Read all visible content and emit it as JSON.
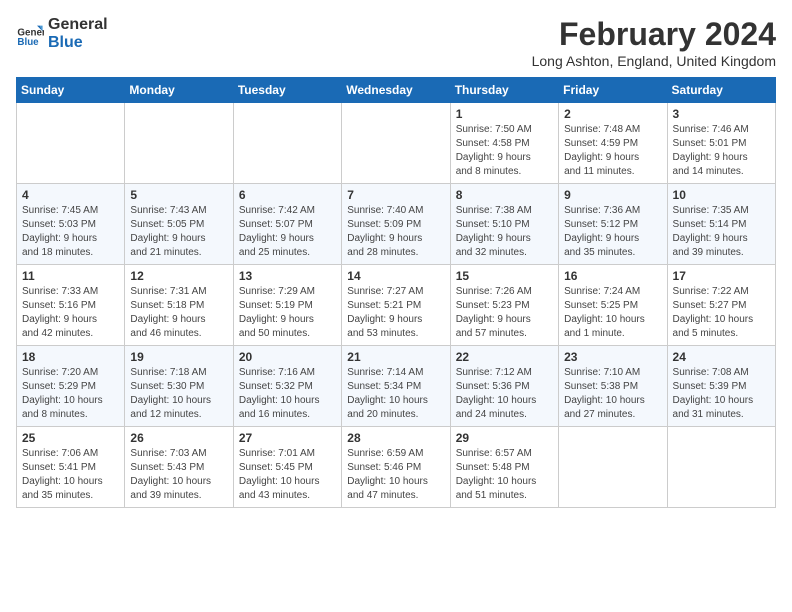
{
  "header": {
    "logo_line1": "General",
    "logo_line2": "Blue",
    "month_year": "February 2024",
    "location": "Long Ashton, England, United Kingdom"
  },
  "weekdays": [
    "Sunday",
    "Monday",
    "Tuesday",
    "Wednesday",
    "Thursday",
    "Friday",
    "Saturday"
  ],
  "weeks": [
    [
      {
        "day": "",
        "info": ""
      },
      {
        "day": "",
        "info": ""
      },
      {
        "day": "",
        "info": ""
      },
      {
        "day": "",
        "info": ""
      },
      {
        "day": "1",
        "info": "Sunrise: 7:50 AM\nSunset: 4:58 PM\nDaylight: 9 hours\nand 8 minutes."
      },
      {
        "day": "2",
        "info": "Sunrise: 7:48 AM\nSunset: 4:59 PM\nDaylight: 9 hours\nand 11 minutes."
      },
      {
        "day": "3",
        "info": "Sunrise: 7:46 AM\nSunset: 5:01 PM\nDaylight: 9 hours\nand 14 minutes."
      }
    ],
    [
      {
        "day": "4",
        "info": "Sunrise: 7:45 AM\nSunset: 5:03 PM\nDaylight: 9 hours\nand 18 minutes."
      },
      {
        "day": "5",
        "info": "Sunrise: 7:43 AM\nSunset: 5:05 PM\nDaylight: 9 hours\nand 21 minutes."
      },
      {
        "day": "6",
        "info": "Sunrise: 7:42 AM\nSunset: 5:07 PM\nDaylight: 9 hours\nand 25 minutes."
      },
      {
        "day": "7",
        "info": "Sunrise: 7:40 AM\nSunset: 5:09 PM\nDaylight: 9 hours\nand 28 minutes."
      },
      {
        "day": "8",
        "info": "Sunrise: 7:38 AM\nSunset: 5:10 PM\nDaylight: 9 hours\nand 32 minutes."
      },
      {
        "day": "9",
        "info": "Sunrise: 7:36 AM\nSunset: 5:12 PM\nDaylight: 9 hours\nand 35 minutes."
      },
      {
        "day": "10",
        "info": "Sunrise: 7:35 AM\nSunset: 5:14 PM\nDaylight: 9 hours\nand 39 minutes."
      }
    ],
    [
      {
        "day": "11",
        "info": "Sunrise: 7:33 AM\nSunset: 5:16 PM\nDaylight: 9 hours\nand 42 minutes."
      },
      {
        "day": "12",
        "info": "Sunrise: 7:31 AM\nSunset: 5:18 PM\nDaylight: 9 hours\nand 46 minutes."
      },
      {
        "day": "13",
        "info": "Sunrise: 7:29 AM\nSunset: 5:19 PM\nDaylight: 9 hours\nand 50 minutes."
      },
      {
        "day": "14",
        "info": "Sunrise: 7:27 AM\nSunset: 5:21 PM\nDaylight: 9 hours\nand 53 minutes."
      },
      {
        "day": "15",
        "info": "Sunrise: 7:26 AM\nSunset: 5:23 PM\nDaylight: 9 hours\nand 57 minutes."
      },
      {
        "day": "16",
        "info": "Sunrise: 7:24 AM\nSunset: 5:25 PM\nDaylight: 10 hours\nand 1 minute."
      },
      {
        "day": "17",
        "info": "Sunrise: 7:22 AM\nSunset: 5:27 PM\nDaylight: 10 hours\nand 5 minutes."
      }
    ],
    [
      {
        "day": "18",
        "info": "Sunrise: 7:20 AM\nSunset: 5:29 PM\nDaylight: 10 hours\nand 8 minutes."
      },
      {
        "day": "19",
        "info": "Sunrise: 7:18 AM\nSunset: 5:30 PM\nDaylight: 10 hours\nand 12 minutes."
      },
      {
        "day": "20",
        "info": "Sunrise: 7:16 AM\nSunset: 5:32 PM\nDaylight: 10 hours\nand 16 minutes."
      },
      {
        "day": "21",
        "info": "Sunrise: 7:14 AM\nSunset: 5:34 PM\nDaylight: 10 hours\nand 20 minutes."
      },
      {
        "day": "22",
        "info": "Sunrise: 7:12 AM\nSunset: 5:36 PM\nDaylight: 10 hours\nand 24 minutes."
      },
      {
        "day": "23",
        "info": "Sunrise: 7:10 AM\nSunset: 5:38 PM\nDaylight: 10 hours\nand 27 minutes."
      },
      {
        "day": "24",
        "info": "Sunrise: 7:08 AM\nSunset: 5:39 PM\nDaylight: 10 hours\nand 31 minutes."
      }
    ],
    [
      {
        "day": "25",
        "info": "Sunrise: 7:06 AM\nSunset: 5:41 PM\nDaylight: 10 hours\nand 35 minutes."
      },
      {
        "day": "26",
        "info": "Sunrise: 7:03 AM\nSunset: 5:43 PM\nDaylight: 10 hours\nand 39 minutes."
      },
      {
        "day": "27",
        "info": "Sunrise: 7:01 AM\nSunset: 5:45 PM\nDaylight: 10 hours\nand 43 minutes."
      },
      {
        "day": "28",
        "info": "Sunrise: 6:59 AM\nSunset: 5:46 PM\nDaylight: 10 hours\nand 47 minutes."
      },
      {
        "day": "29",
        "info": "Sunrise: 6:57 AM\nSunset: 5:48 PM\nDaylight: 10 hours\nand 51 minutes."
      },
      {
        "day": "",
        "info": ""
      },
      {
        "day": "",
        "info": ""
      }
    ]
  ]
}
